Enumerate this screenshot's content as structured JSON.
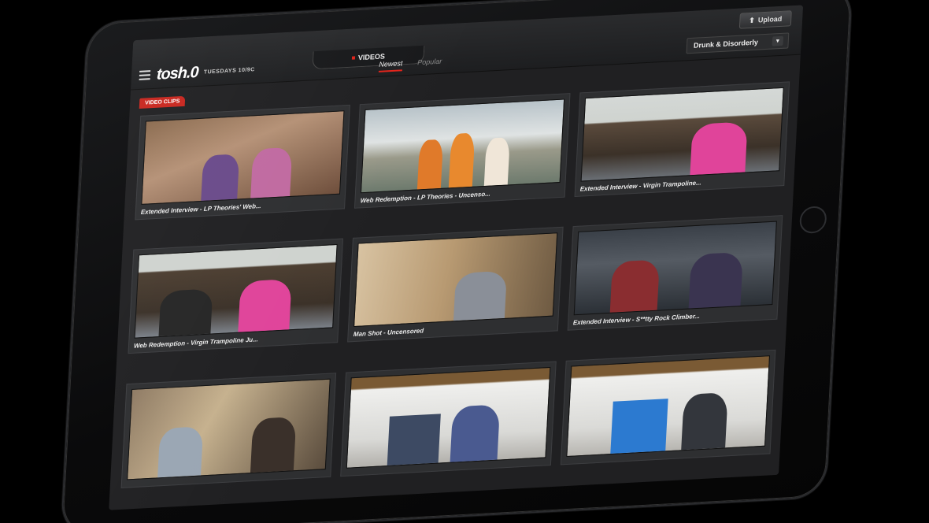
{
  "header": {
    "upload_label": "Upload",
    "logo_text": "tosh.0",
    "tagline": "TUESDAYS 10/9C",
    "section_title": "VIDEOS",
    "sort_tabs": [
      "Newest",
      "Popular"
    ],
    "active_sort": "Newest",
    "category_selected": "Drunk & Disorderly"
  },
  "section_badge": "VIDEO CLIPS",
  "videos": [
    {
      "title": "Extended Interview - LP Theories' Web..."
    },
    {
      "title": "Web Redemption - LP Theories - Uncenso..."
    },
    {
      "title": "Extended Interview - Virgin Trampoline..."
    },
    {
      "title": "Web Redemption - Virgin Trampoline Ju..."
    },
    {
      "title": "Man Shot - Uncensored"
    },
    {
      "title": "Extended Interview - S**tty Rock Climber..."
    },
    {
      "title": ""
    },
    {
      "title": ""
    },
    {
      "title": ""
    }
  ],
  "colors": {
    "accent_red": "#e2231a",
    "badge_red": "#c8261e",
    "screen_bg": "#202022"
  }
}
